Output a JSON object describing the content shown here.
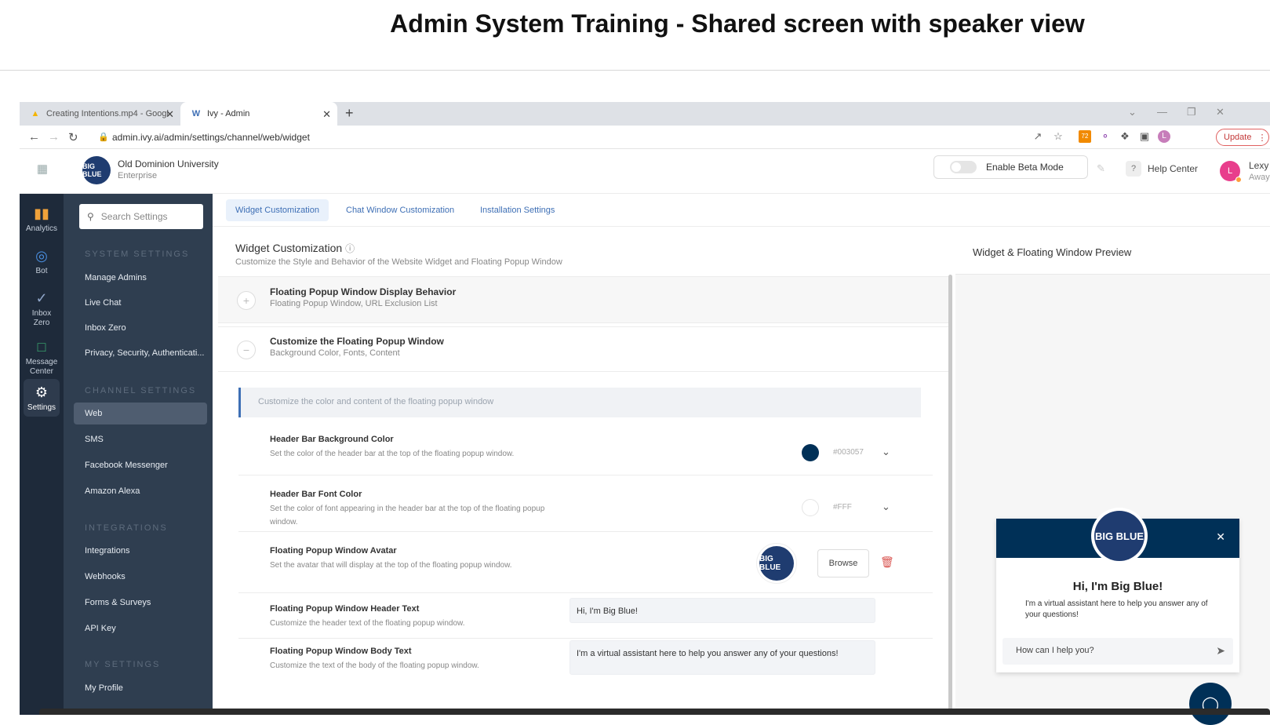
{
  "page_title": "Admin System Training - Shared screen with speaker view",
  "browser": {
    "tabs": [
      {
        "label": "Creating Intentions.mp4 - Googl",
        "active": false
      },
      {
        "label": "Ivy - Admin",
        "active": true
      }
    ],
    "url": "admin.ivy.ai/admin/settings/channel/web/widget",
    "update_label": "Update",
    "profile_initial": "L",
    "extension_badge": "72"
  },
  "header": {
    "org_name": "Old Dominion University",
    "org_plan": "Enterprise",
    "beta_label": "Enable Beta Mode",
    "help_label": "Help Center",
    "user_initial": "L",
    "user_name": "Lexy",
    "user_status": "Away"
  },
  "rail": [
    {
      "label": "Analytics",
      "icon": "bar-chart-icon"
    },
    {
      "label": "Bot",
      "icon": "bot-icon"
    },
    {
      "label": "Inbox Zero",
      "icon": "check-circle-icon"
    },
    {
      "label": "Message Center",
      "icon": "message-icon"
    },
    {
      "label": "Settings",
      "icon": "gear-icon"
    }
  ],
  "sidebar": {
    "search_placeholder": "Search Settings",
    "system_head": "SYSTEM SETTINGS",
    "system_items": [
      "Manage Admins",
      "Live Chat",
      "Inbox Zero",
      "Privacy, Security, Authenticati..."
    ],
    "channel_head": "CHANNEL SETTINGS",
    "channel_items": [
      "Web",
      "SMS",
      "Facebook Messenger",
      "Amazon Alexa"
    ],
    "integrations_head": "INTEGRATIONS",
    "integration_items": [
      "Integrations",
      "Webhooks",
      "Forms & Surveys",
      "API Key"
    ],
    "my_head": "MY SETTINGS",
    "my_items": [
      "My Profile"
    ]
  },
  "subtabs": [
    "Widget Customization",
    "Chat Window Customization",
    "Installation Settings"
  ],
  "panel": {
    "title": "Widget Customization",
    "subtitle": "Customize the Style and Behavior of the Website Widget and Floating Popup Window",
    "sections": [
      {
        "title": "Floating Popup Window Display Behavior",
        "sub": "Floating Popup Window, URL Exclusion List",
        "icon": "+"
      },
      {
        "title": "Customize the Floating Popup Window",
        "sub": "Background Color, Fonts, Content",
        "icon": "−"
      }
    ],
    "info": "Customize the color and content of the floating popup window",
    "rows": [
      {
        "label": "Header Bar Background Color",
        "desc": "Set the color of the header bar at the top of the floating popup window.",
        "hex": "#003057"
      },
      {
        "label": "Header Bar Font Color",
        "desc": "Set the color of font appearing in the header bar at the top of the floating popup window.",
        "hex": "#FFF"
      },
      {
        "label": "Floating Popup Window Avatar",
        "desc": "Set the avatar that will display at the top of the floating popup window.",
        "browse": "Browse"
      },
      {
        "label": "Floating Popup Window Header Text",
        "desc": "Customize the header text of the floating popup window.",
        "value": "Hi, I'm Big Blue!"
      },
      {
        "label": "Floating Popup Window Body Text",
        "desc": "Customize the text of the body of the floating popup window.",
        "value": "I'm a virtual assistant here to help you answer any of your questions!"
      }
    ]
  },
  "preview": {
    "title": "Widget & Floating Window Preview",
    "popup_title": "Hi, I'm Big Blue!",
    "popup_body": "I'm a virtual assistant here to help you answer any of your questions!",
    "popup_input": "How can I help you?"
  },
  "logo_text": "BIG BLUE",
  "colors": {
    "header_bar": "#003057",
    "accent": "#3e6fb5",
    "rail": "#1e2a3a",
    "sidebar": "#2f3e50"
  }
}
